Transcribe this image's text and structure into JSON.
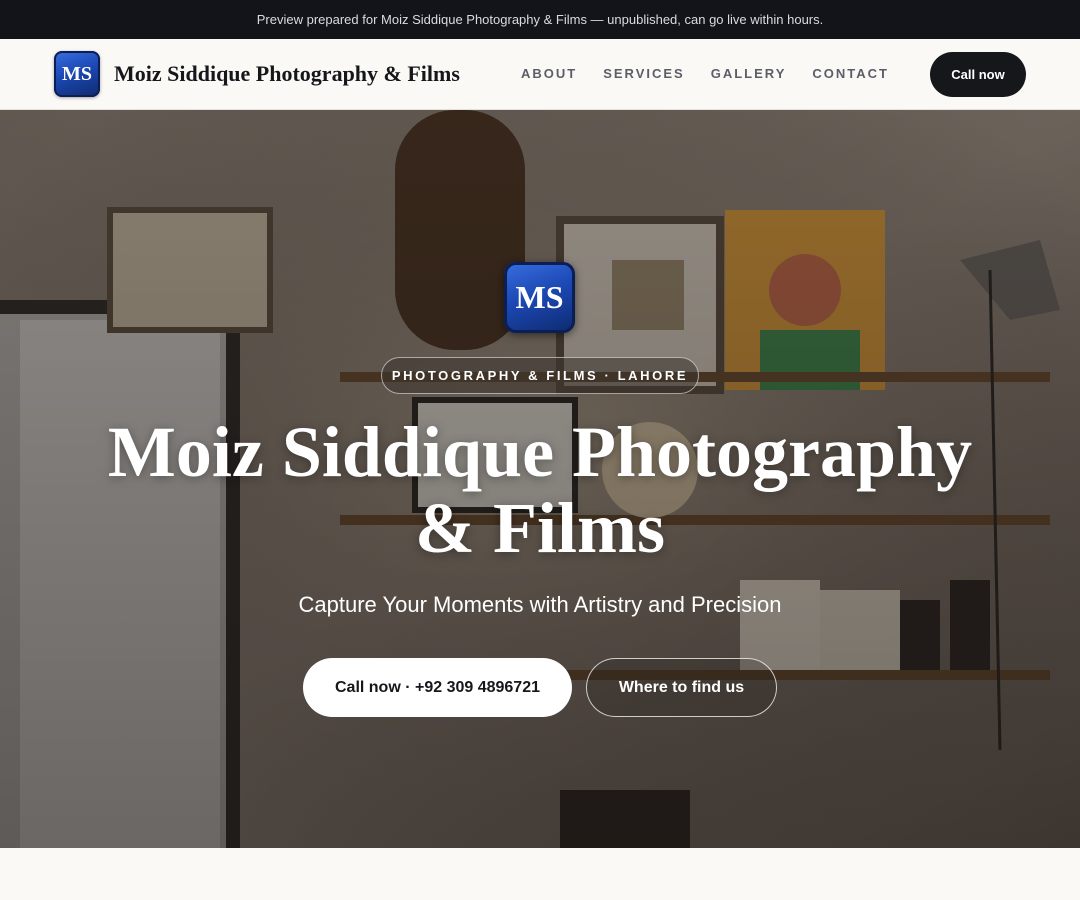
{
  "preview_banner": {
    "text": "Preview prepared for Moiz Siddique Photography & Films — unpublished, can go live within hours."
  },
  "header": {
    "logo_initials": "MS",
    "brand_name": "Moiz Siddique Photography & Films",
    "nav": [
      {
        "label": "ABOUT"
      },
      {
        "label": "SERVICES"
      },
      {
        "label": "GALLERY"
      },
      {
        "label": "CONTACT"
      }
    ],
    "cta_label": "Call now"
  },
  "hero": {
    "logo_initials": "MS",
    "eyebrow": "PHOTOGRAPHY & FILMS · LAHORE",
    "title": "Moiz Siddique Photography & Films",
    "tagline": "Capture Your Moments with Artistry and Precision",
    "primary_button": "Call now · +92 309 4896721",
    "secondary_button": "Where to find us"
  },
  "colors": {
    "banner_bg": "#121419",
    "logo_blue": "#1c49b5",
    "cta_dark": "#16171b",
    "page_bg": "#faf9f6"
  }
}
